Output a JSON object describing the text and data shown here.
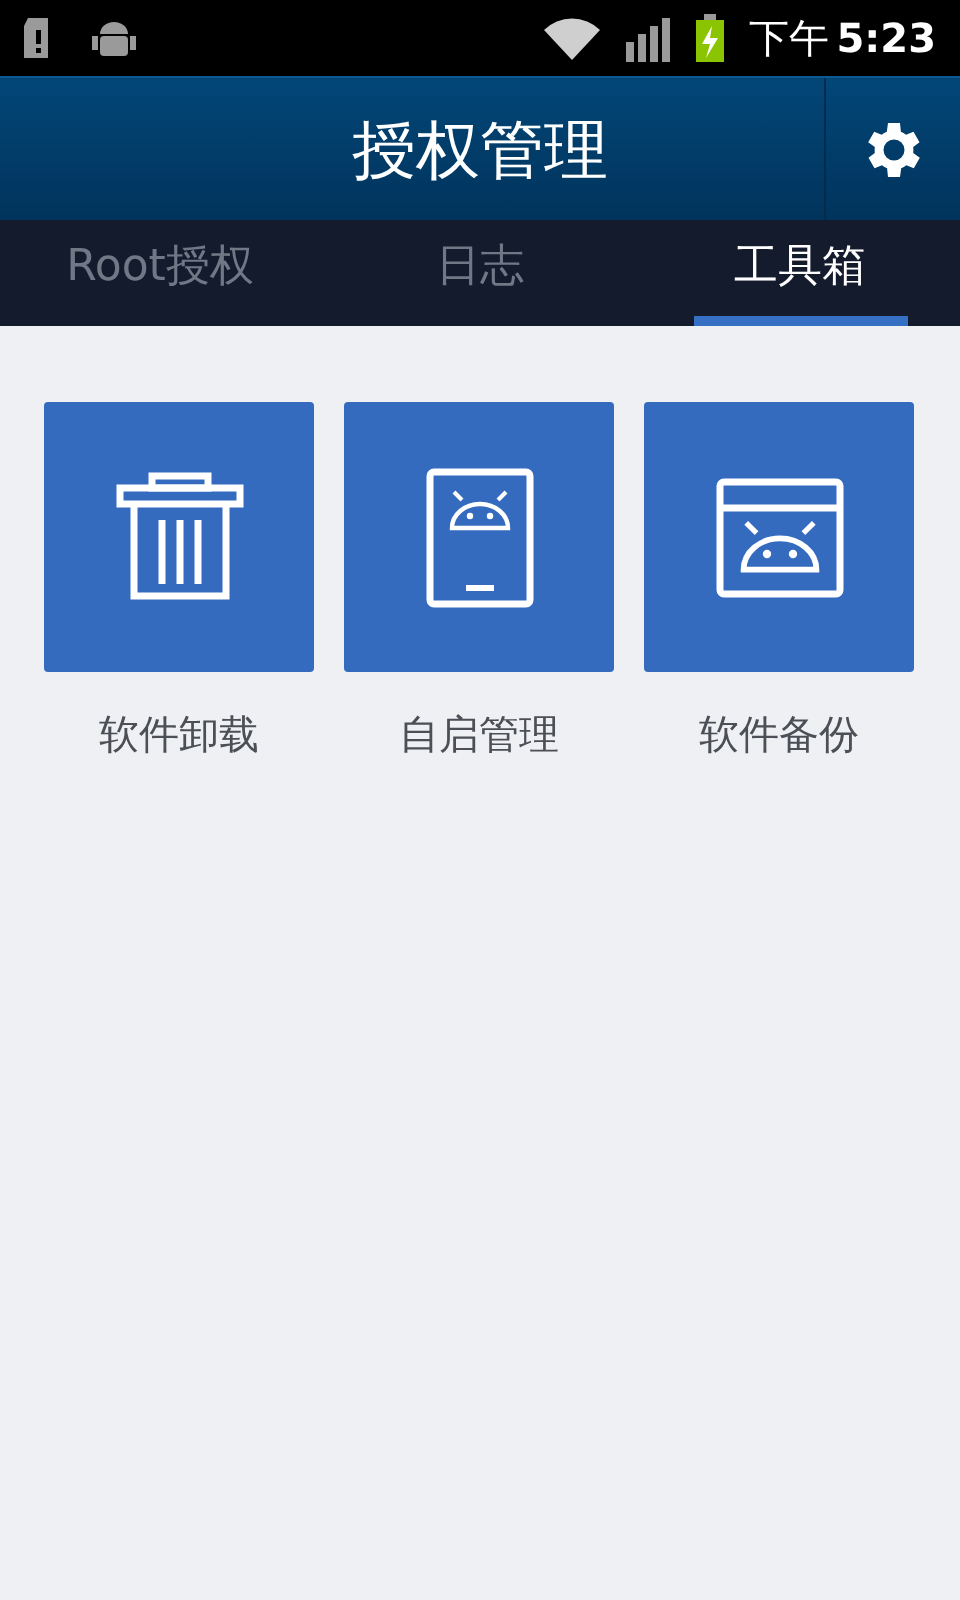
{
  "status_bar": {
    "period": "下午",
    "time": "5:23"
  },
  "header": {
    "title": "授权管理"
  },
  "tabs": [
    {
      "label": "Root授权",
      "selected": false
    },
    {
      "label": "日志",
      "selected": false
    },
    {
      "label": "工具箱",
      "selected": true
    }
  ],
  "tools": [
    {
      "kind": "trash",
      "label": "软件卸载"
    },
    {
      "kind": "phone",
      "label": "自启管理"
    },
    {
      "kind": "window",
      "label": "软件备份"
    }
  ]
}
